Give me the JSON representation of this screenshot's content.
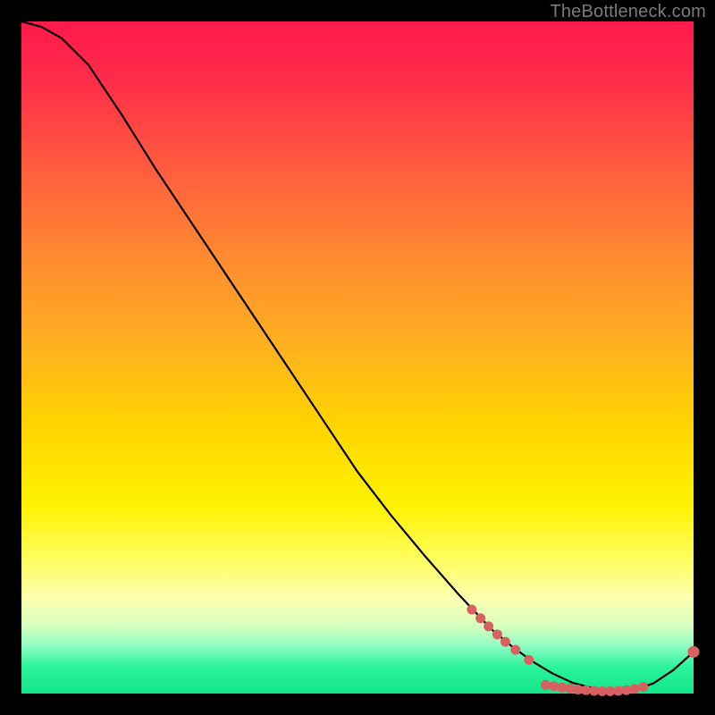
{
  "watermark": "TheBottleneck.com",
  "colors": {
    "background": "#000000",
    "marker": "#d86060",
    "curve": "#000000"
  },
  "chart_data": {
    "type": "line",
    "title": "",
    "xlabel": "",
    "ylabel": "",
    "xlim": [
      0,
      100
    ],
    "ylim": [
      0,
      100
    ],
    "grid": false,
    "legend": false,
    "series": [
      {
        "name": "bottleneck-curve",
        "x": [
          0,
          3,
          6,
          10,
          15,
          20,
          25,
          30,
          35,
          40,
          45,
          50,
          55,
          60,
          65,
          70,
          73,
          76,
          79,
          82,
          85,
          88,
          91,
          94,
          97,
          100
        ],
        "y": [
          100,
          99.2,
          97.5,
          93.5,
          86,
          78,
          70.5,
          63,
          55.5,
          48,
          40.5,
          33,
          26.5,
          20.5,
          14.8,
          9.5,
          7.0,
          4.8,
          3.0,
          1.6,
          0.8,
          0.4,
          0.5,
          1.5,
          3.5,
          6.2
        ]
      }
    ],
    "markers": [
      {
        "x": 67.0,
        "y": 12.5,
        "r": 5.5
      },
      {
        "x": 68.3,
        "y": 11.2,
        "r": 5.5
      },
      {
        "x": 69.5,
        "y": 10.0,
        "r": 5.5
      },
      {
        "x": 70.8,
        "y": 8.8,
        "r": 5.5
      },
      {
        "x": 72.0,
        "y": 7.7,
        "r": 5.5
      },
      {
        "x": 73.5,
        "y": 6.5,
        "r": 5.5
      },
      {
        "x": 75.5,
        "y": 5.0,
        "r": 5.5
      },
      {
        "x": 78.0,
        "y": 1.3,
        "r": 5.5
      },
      {
        "x": 79.2,
        "y": 1.1,
        "r": 5.5
      },
      {
        "x": 80.4,
        "y": 0.9,
        "r": 5.5
      },
      {
        "x": 81.6,
        "y": 0.75,
        "r": 5.5
      },
      {
        "x": 82.8,
        "y": 0.6,
        "r": 5.5
      },
      {
        "x": 84.0,
        "y": 0.5,
        "r": 5.5
      },
      {
        "x": 85.2,
        "y": 0.4,
        "r": 5.5
      },
      {
        "x": 86.4,
        "y": 0.35,
        "r": 5.5
      },
      {
        "x": 87.6,
        "y": 0.35,
        "r": 5.5
      },
      {
        "x": 88.8,
        "y": 0.4,
        "r": 5.5
      },
      {
        "x": 90.0,
        "y": 0.5,
        "r": 5.5
      },
      {
        "x": 91.2,
        "y": 0.7,
        "r": 5.5
      },
      {
        "x": 92.5,
        "y": 1.0,
        "r": 5.5
      },
      {
        "x": 100.0,
        "y": 6.2,
        "r": 6.5
      }
    ]
  }
}
